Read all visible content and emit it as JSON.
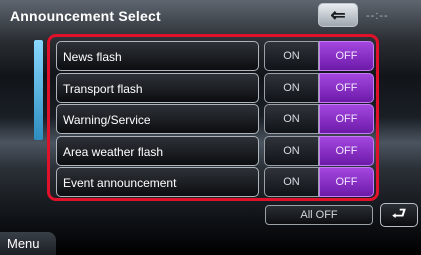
{
  "header": {
    "title": "Announcement Select",
    "back_icon": "arrow-left-icon",
    "status_text": "--:--"
  },
  "announcements": [
    {
      "label": "News flash",
      "on_label": "ON",
      "off_label": "OFF",
      "selected": "OFF"
    },
    {
      "label": "Transport flash",
      "on_label": "ON",
      "off_label": "OFF",
      "selected": "OFF"
    },
    {
      "label": "Warning/Service",
      "on_label": "ON",
      "off_label": "OFF",
      "selected": "OFF"
    },
    {
      "label": "Area weather flash",
      "on_label": "ON",
      "off_label": "OFF",
      "selected": "OFF"
    },
    {
      "label": "Event announcement",
      "on_label": "ON",
      "off_label": "OFF",
      "selected": "OFF"
    }
  ],
  "footer": {
    "all_off_label": "All OFF",
    "return_icon": "return-icon",
    "menu_label": "Menu"
  },
  "colors": {
    "selected": "#8a2fd0",
    "highlight_frame": "#e0112b",
    "accent": "#4fb4e6"
  }
}
